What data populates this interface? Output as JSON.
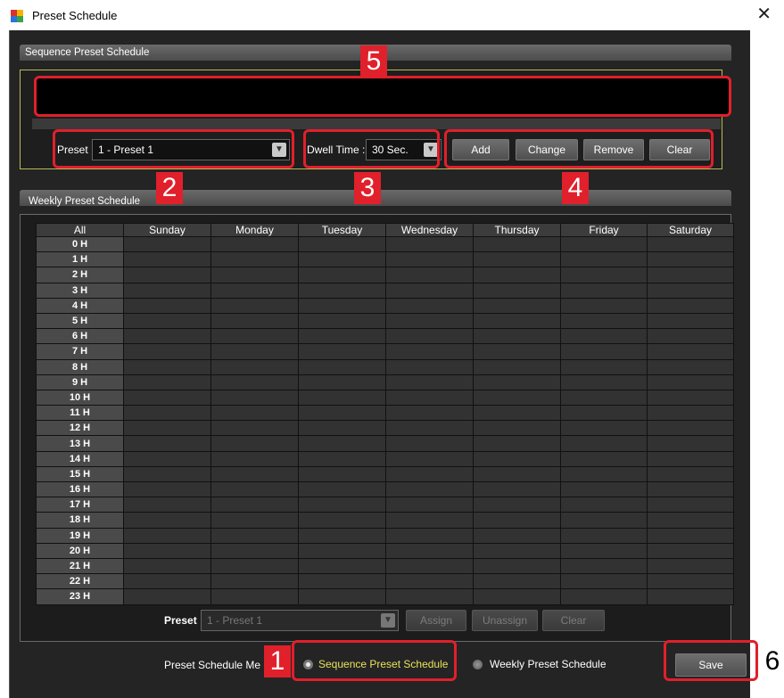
{
  "window": {
    "title": "Preset Schedule"
  },
  "icons": {
    "app_colors": [
      "#d9342b",
      "#f4b400",
      "#2b73d9",
      "#3aa04a"
    ]
  },
  "sequence": {
    "header": "Sequence Preset Schedule",
    "preset_label": "Preset :",
    "preset_value": "1  - Preset 1",
    "dwell_label": "Dwell Time :",
    "dwell_value": "30 Sec.",
    "buttons": {
      "add": "Add",
      "change": "Change",
      "remove": "Remove",
      "clear": "Clear"
    }
  },
  "weekly": {
    "header": "Weekly Preset Schedule",
    "columns": [
      "All",
      "Sunday",
      "Monday",
      "Tuesday",
      "Wednesday",
      "Thursday",
      "Friday",
      "Saturday"
    ],
    "hours": [
      "0 H",
      "1 H",
      "2 H",
      "3 H",
      "4 H",
      "5 H",
      "6 H",
      "7 H",
      "8 H",
      "9 H",
      "10 H",
      "11 H",
      "12 H",
      "13 H",
      "14 H",
      "15 H",
      "16 H",
      "17 H",
      "18 H",
      "19 H",
      "20 H",
      "21 H",
      "22 H",
      "23 H"
    ],
    "preset_label": "Preset :",
    "preset_value": "1  - Preset 1",
    "buttons": {
      "assign": "Assign",
      "unassign": "Unassign",
      "clear": "Clear"
    }
  },
  "mode": {
    "label": "Preset Schedule Me",
    "options": [
      "Sequence Preset Schedule",
      "Weekly Preset Schedule"
    ],
    "selected": "Sequence Preset Schedule"
  },
  "save_label": "Save",
  "markers": [
    "1",
    "2",
    "3",
    "4",
    "5",
    "6"
  ],
  "colors": {
    "highlight": "#e0202b",
    "selected_text": "#e8e25a",
    "frame_accent": "#b8ba5a"
  }
}
